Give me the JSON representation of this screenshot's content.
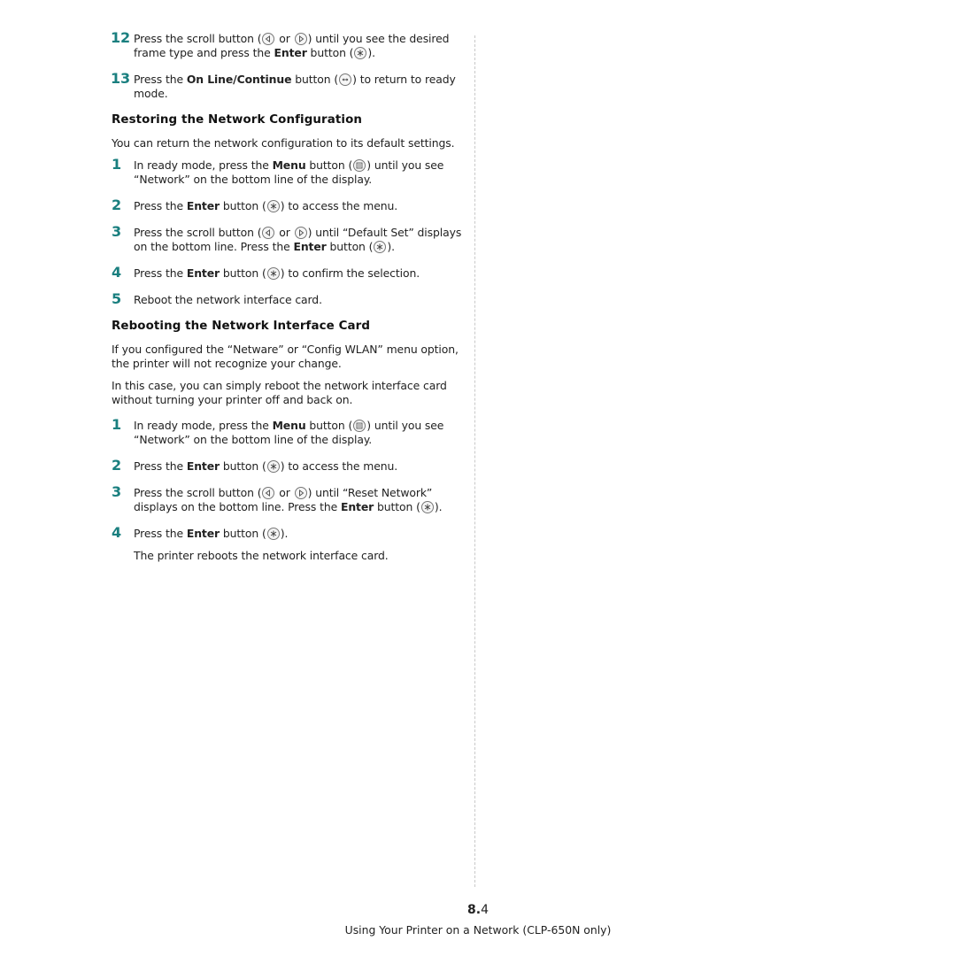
{
  "section1": {
    "steps": [
      {
        "num": "12",
        "parts": [
          "Press the scroll button (",
          " or ",
          ") until you see the desired frame type and press the ",
          "Enter",
          " button (",
          ")."
        ]
      },
      {
        "num": "13",
        "parts": [
          "Press the ",
          "On Line/Continue",
          " button (",
          ") to return to ready mode."
        ]
      }
    ]
  },
  "restore": {
    "title": "Restoring the Network Configuration",
    "intro": "You can return the network configuration to its default settings.",
    "steps": [
      {
        "num": "1",
        "a": "In ready mode, press the ",
        "b": "Menu",
        "c": " button (",
        "d": ") until you see “Network” on the bottom line of the display."
      },
      {
        "num": "2",
        "a": "Press the ",
        "b": "Enter",
        "c": " button (",
        "d": ") to access the menu."
      },
      {
        "num": "3",
        "a": "Press the scroll button (",
        "or": " or ",
        "c": ") until “Default Set” displays on the bottom line. Press the ",
        "b": "Enter",
        "e": " button (",
        "d": ")."
      },
      {
        "num": "4",
        "a": "Press the ",
        "b": "Enter",
        "c": " button (",
        "d": ") to confirm the selection."
      },
      {
        "num": "5",
        "a": "Reboot the network interface card."
      }
    ]
  },
  "reboot": {
    "title": "Rebooting the Network Interface Card",
    "para1": "If you configured the “Netware” or “Config WLAN” menu option, the printer will not recognize your change.",
    "para2": "In this case, you can simply reboot the network interface card without turning your printer off and back on.",
    "steps": [
      {
        "num": "1",
        "a": "In ready mode, press the ",
        "b": "Menu",
        "c": " button (",
        "d": ") until you see “Network” on the bottom line of the display."
      },
      {
        "num": "2",
        "a": "Press the ",
        "b": "Enter",
        "c": " button (",
        "d": ") to access the menu."
      },
      {
        "num": "3",
        "a": "Press the scroll button (",
        "or": " or ",
        "c": ") until “Reset Network” displays on the bottom line. Press the ",
        "b": "Enter",
        "e": " button (",
        "d": ")."
      },
      {
        "num": "4",
        "a": "Press the ",
        "b": "Enter",
        "c": " button (",
        "d": ")."
      }
    ],
    "result": "The printer reboots the network interface card."
  },
  "page": {
    "chapter": "8.",
    "number": "4",
    "footer": "Using Your Printer on a Network (CLP-650N only)"
  },
  "colors": {
    "step_number": "#1a7f7f",
    "divider": "#c8c8c8"
  }
}
